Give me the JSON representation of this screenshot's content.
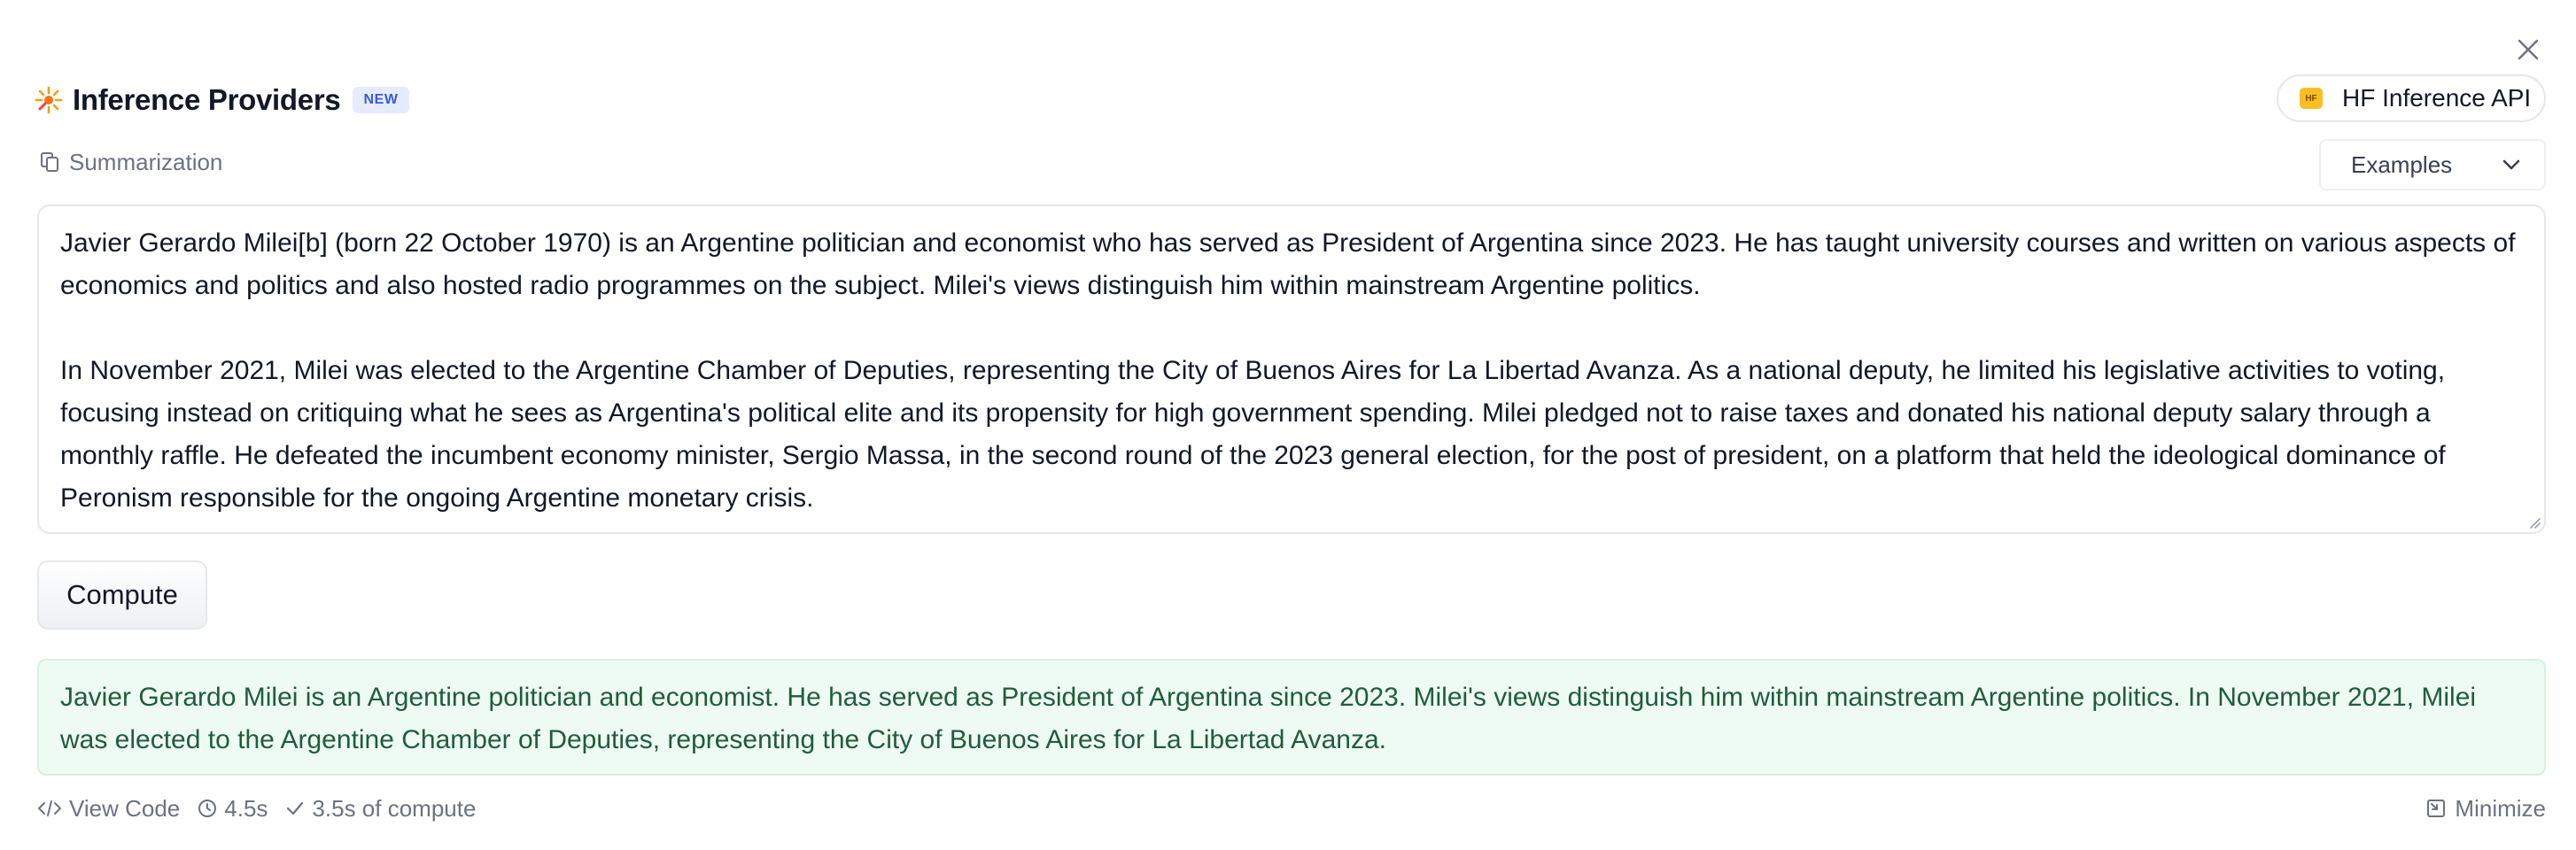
{
  "header": {
    "title": "Inference Providers",
    "badge": "NEW",
    "provider_label": "HF Inference API",
    "provider_logo_text": "HF",
    "close_icon": "close-icon",
    "title_icon": "sparkle-icon"
  },
  "task": {
    "label": "Summarization",
    "icon": "document-copy-icon",
    "examples_label": "Examples"
  },
  "input": {
    "paragraphs": [
      "Javier Gerardo Milei[b] (born 22 October 1970) is an Argentine politician and economist who has served as President of Argentina since 2023. He has taught university courses and written on various aspects of economics and politics and also hosted radio programmes on the subject. Milei's views distinguish him within mainstream Argentine politics.",
      "In November 2021, Milei was elected to the Argentine Chamber of Deputies, representing the City of Buenos Aires for La Libertad Avanza. As a national deputy, he limited his legislative activities to voting, focusing instead on critiquing what he sees as Argentina's political elite and its propensity for high government spending. Milei pledged not to raise taxes and donated his national deputy salary through a monthly raffle. He defeated the incumbent economy minister, Sergio Massa, in the second round of the 2023 general election, for the post of president, on a platform that held the ideological dominance of Peronism responsible for the ongoing Argentine monetary crisis."
    ]
  },
  "compute_label": "Compute",
  "output": {
    "text": "Javier Gerardo Milei is an Argentine politician and economist. He has served as President of Argentina since 2023. Milei's views distinguish him within mainstream Argentine politics. In November 2021, Milei was elected to the Argentine Chamber of Deputies, representing the City of Buenos Aires for La Libertad Avanza."
  },
  "footer": {
    "view_code": "View Code",
    "time": "4.5s",
    "compute_time": "3.5s of compute",
    "minimize": "Minimize"
  },
  "colors": {
    "badge_bg": "#e6ecff",
    "badge_text": "#3b5bdb",
    "output_bg": "#eefbf3",
    "output_text": "#1f5d3a",
    "hf_logo": "#fbbf24"
  }
}
